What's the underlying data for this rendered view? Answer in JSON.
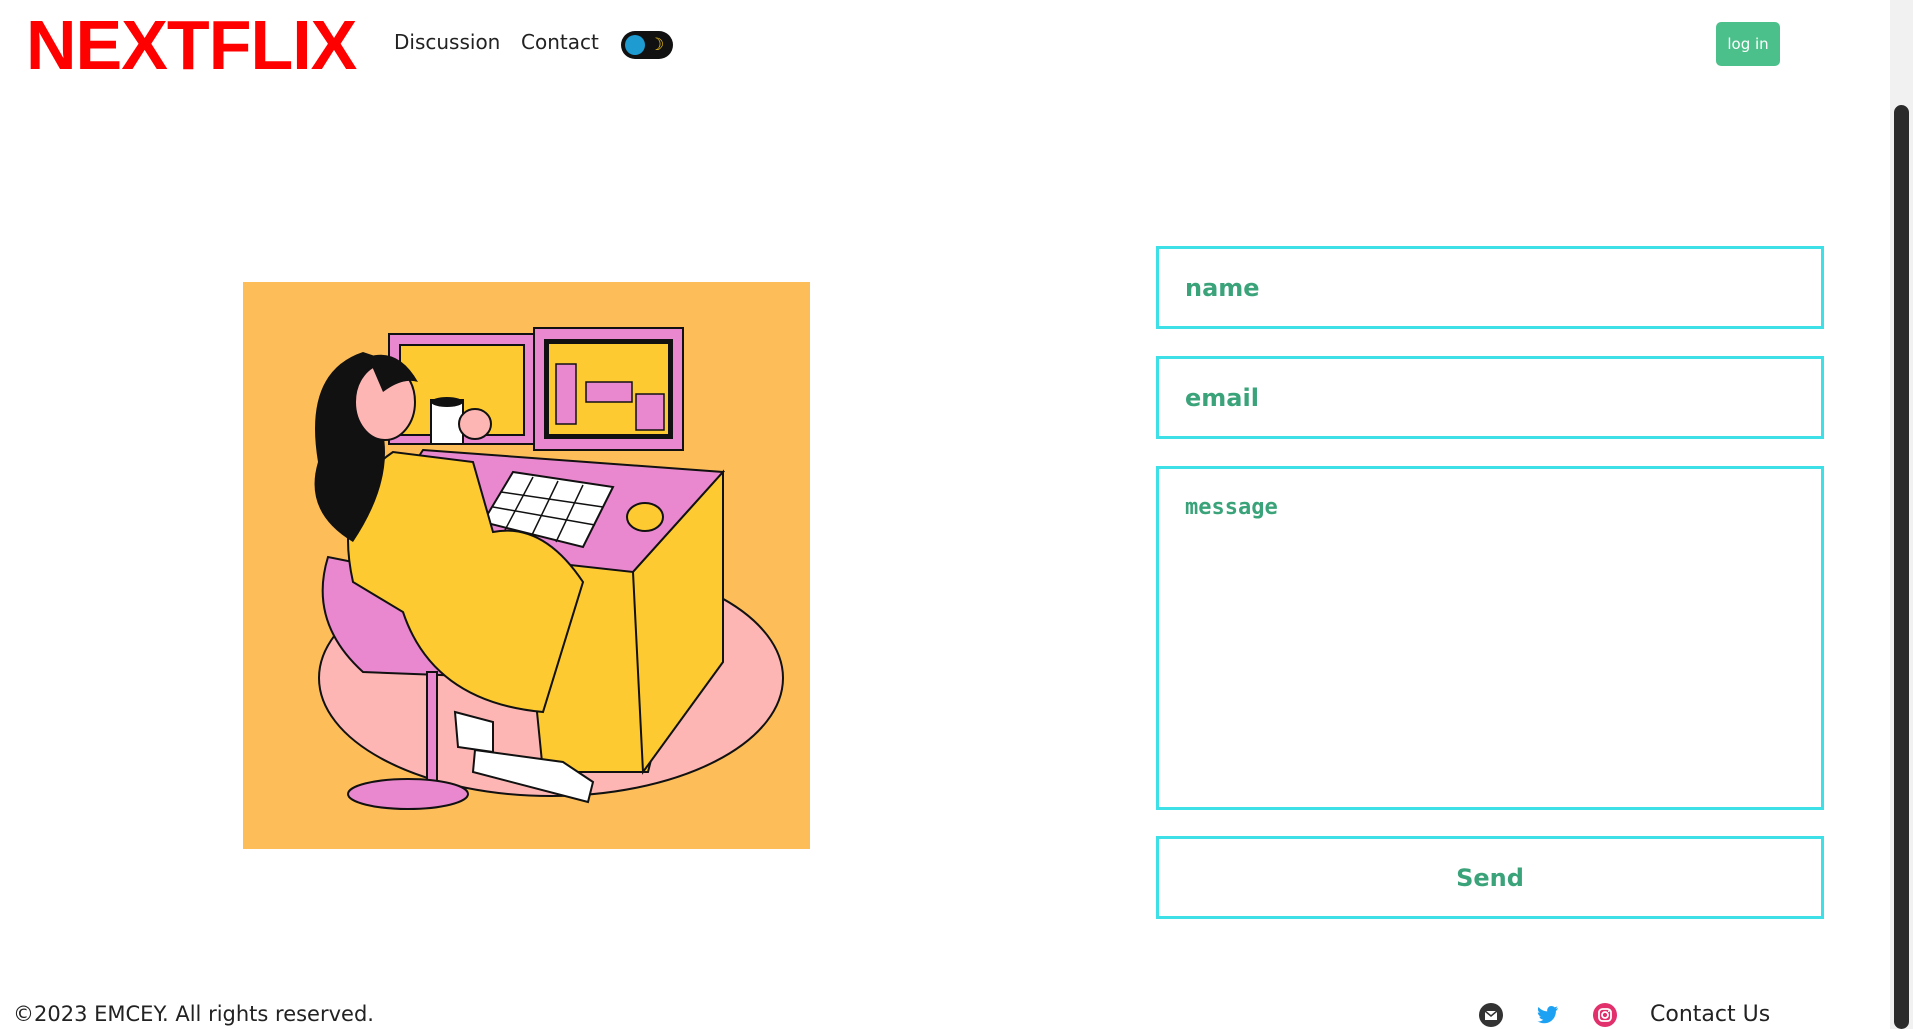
{
  "header": {
    "logo": "NEXTFLIX",
    "nav": [
      "Discussion",
      "Contact"
    ],
    "login_label": "log in",
    "theme_toggle_icon": "moon-icon"
  },
  "form": {
    "name_placeholder": "name",
    "email_placeholder": "email",
    "message_placeholder": "message",
    "send_label": "Send"
  },
  "footer": {
    "copyright": "©2023 EMCEY. All rights reserved.",
    "contact_label": "Contact Us",
    "social_icons": [
      "mail-icon",
      "twitter-icon",
      "instagram-icon"
    ]
  },
  "colors": {
    "logo": "#ff0000",
    "accent": "#4cc08a",
    "field_border": "#3ce0e6",
    "field_text": "#3aa37a",
    "illustration_bg": "#fdbe5a"
  }
}
